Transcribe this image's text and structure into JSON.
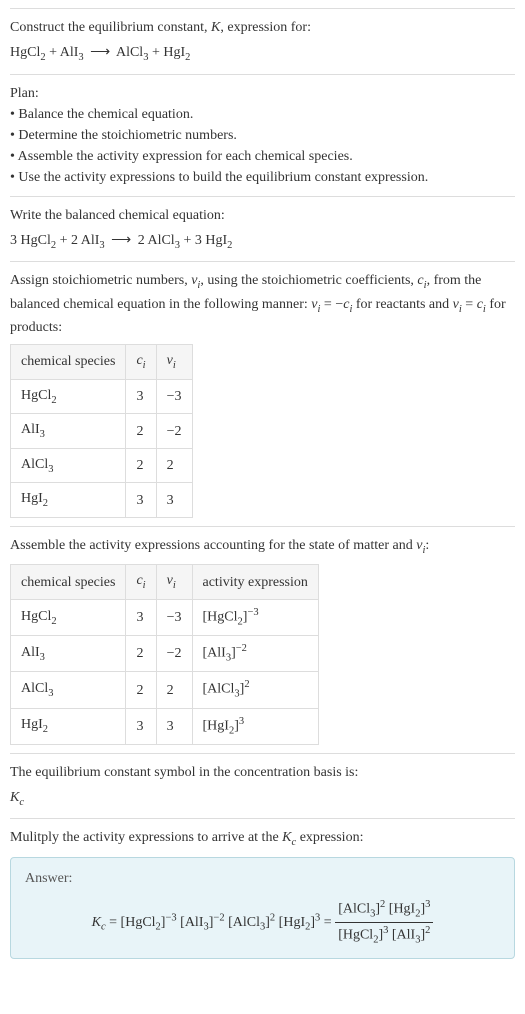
{
  "intro": {
    "line1_pre": "Construct the equilibrium constant, ",
    "line1_K": "K",
    "line1_post": ", expression for:",
    "eq_r1": "HgCl",
    "eq_r1_sub": "2",
    "eq_r2": "AlI",
    "eq_r2_sub": "3",
    "arrow": "⟶",
    "eq_p1": "AlCl",
    "eq_p1_sub": "3",
    "eq_p2": "HgI",
    "eq_p2_sub": "2"
  },
  "plan": {
    "heading": "Plan:",
    "b1": "• Balance the chemical equation.",
    "b2": "• Determine the stoichiometric numbers.",
    "b3": "• Assemble the activity expression for each chemical species.",
    "b4": "• Use the activity expressions to build the equilibrium constant expression."
  },
  "balanced": {
    "heading": "Write the balanced chemical equation:",
    "c1": "3",
    "r1": "HgCl",
    "r1_sub": "2",
    "c2": "2",
    "r2": "AlI",
    "r2_sub": "3",
    "arrow": "⟶",
    "c3": "2",
    "p1": "AlCl",
    "p1_sub": "3",
    "c4": "3",
    "p2": "HgI",
    "p2_sub": "2"
  },
  "assign": {
    "text_pre": "Assign stoichiometric numbers, ",
    "nu": "ν",
    "i": "i",
    "text_mid1": ", using the stoichiometric coefficients, ",
    "c": "c",
    "text_mid2": ", from the balanced chemical equation in the following manner: ",
    "eq_react": " = −",
    "text_react": " for reactants and ",
    "eq_prod": " = ",
    "text_prod": " for products:",
    "h1": "chemical species",
    "h2_c": "c",
    "h2_i": "i",
    "h3_nu": "ν",
    "h3_i": "i",
    "rows": [
      {
        "sp": "HgCl",
        "sp_sub": "2",
        "c": "3",
        "nu": "−3"
      },
      {
        "sp": "AlI",
        "sp_sub": "3",
        "c": "2",
        "nu": "−2"
      },
      {
        "sp": "AlCl",
        "sp_sub": "3",
        "c": "2",
        "nu": "2"
      },
      {
        "sp": "HgI",
        "sp_sub": "2",
        "c": "3",
        "nu": "3"
      }
    ]
  },
  "activity": {
    "text_pre": "Assemble the activity expressions accounting for the state of matter and ",
    "nu": "ν",
    "i": "i",
    "colon": ":",
    "h1": "chemical species",
    "h2_c": "c",
    "h2_i": "i",
    "h3_nu": "ν",
    "h3_i": "i",
    "h4": "activity expression",
    "rows": [
      {
        "sp": "HgCl",
        "sp_sub": "2",
        "c": "3",
        "nu": "−3",
        "a_sp": "HgCl",
        "a_sub": "2",
        "a_sup": "−3"
      },
      {
        "sp": "AlI",
        "sp_sub": "3",
        "c": "2",
        "nu": "−2",
        "a_sp": "AlI",
        "a_sub": "3",
        "a_sup": "−2"
      },
      {
        "sp": "AlCl",
        "sp_sub": "3",
        "c": "2",
        "nu": "2",
        "a_sp": "AlCl",
        "a_sub": "3",
        "a_sup": "2"
      },
      {
        "sp": "HgI",
        "sp_sub": "2",
        "c": "3",
        "nu": "3",
        "a_sp": "HgI",
        "a_sub": "2",
        "a_sup": "3"
      }
    ]
  },
  "kc_symbol": {
    "text": "The equilibrium constant symbol in the concentration basis is:",
    "K": "K",
    "c": "c"
  },
  "multiply": {
    "text_pre": "Mulitply the activity expressions to arrive at the ",
    "K": "K",
    "c": "c",
    "text_post": " expression:"
  },
  "answer": {
    "label": "Answer:",
    "K": "K",
    "c": "c",
    "eq": " = ",
    "t1_sp": "HgCl",
    "t1_sub": "2",
    "t1_sup": "−3",
    "t2_sp": "AlI",
    "t2_sub": "3",
    "t2_sup": "−2",
    "t3_sp": "AlCl",
    "t3_sub": "3",
    "t3_sup": "2",
    "t4_sp": "HgI",
    "t4_sub": "2",
    "t4_sup": "3",
    "eq2": " = ",
    "n1_sp": "AlCl",
    "n1_sub": "3",
    "n1_sup": "2",
    "n2_sp": "HgI",
    "n2_sub": "2",
    "n2_sup": "3",
    "d1_sp": "HgCl",
    "d1_sub": "2",
    "d1_sup": "3",
    "d2_sp": "AlI",
    "d2_sub": "3",
    "d2_sup": "2"
  }
}
